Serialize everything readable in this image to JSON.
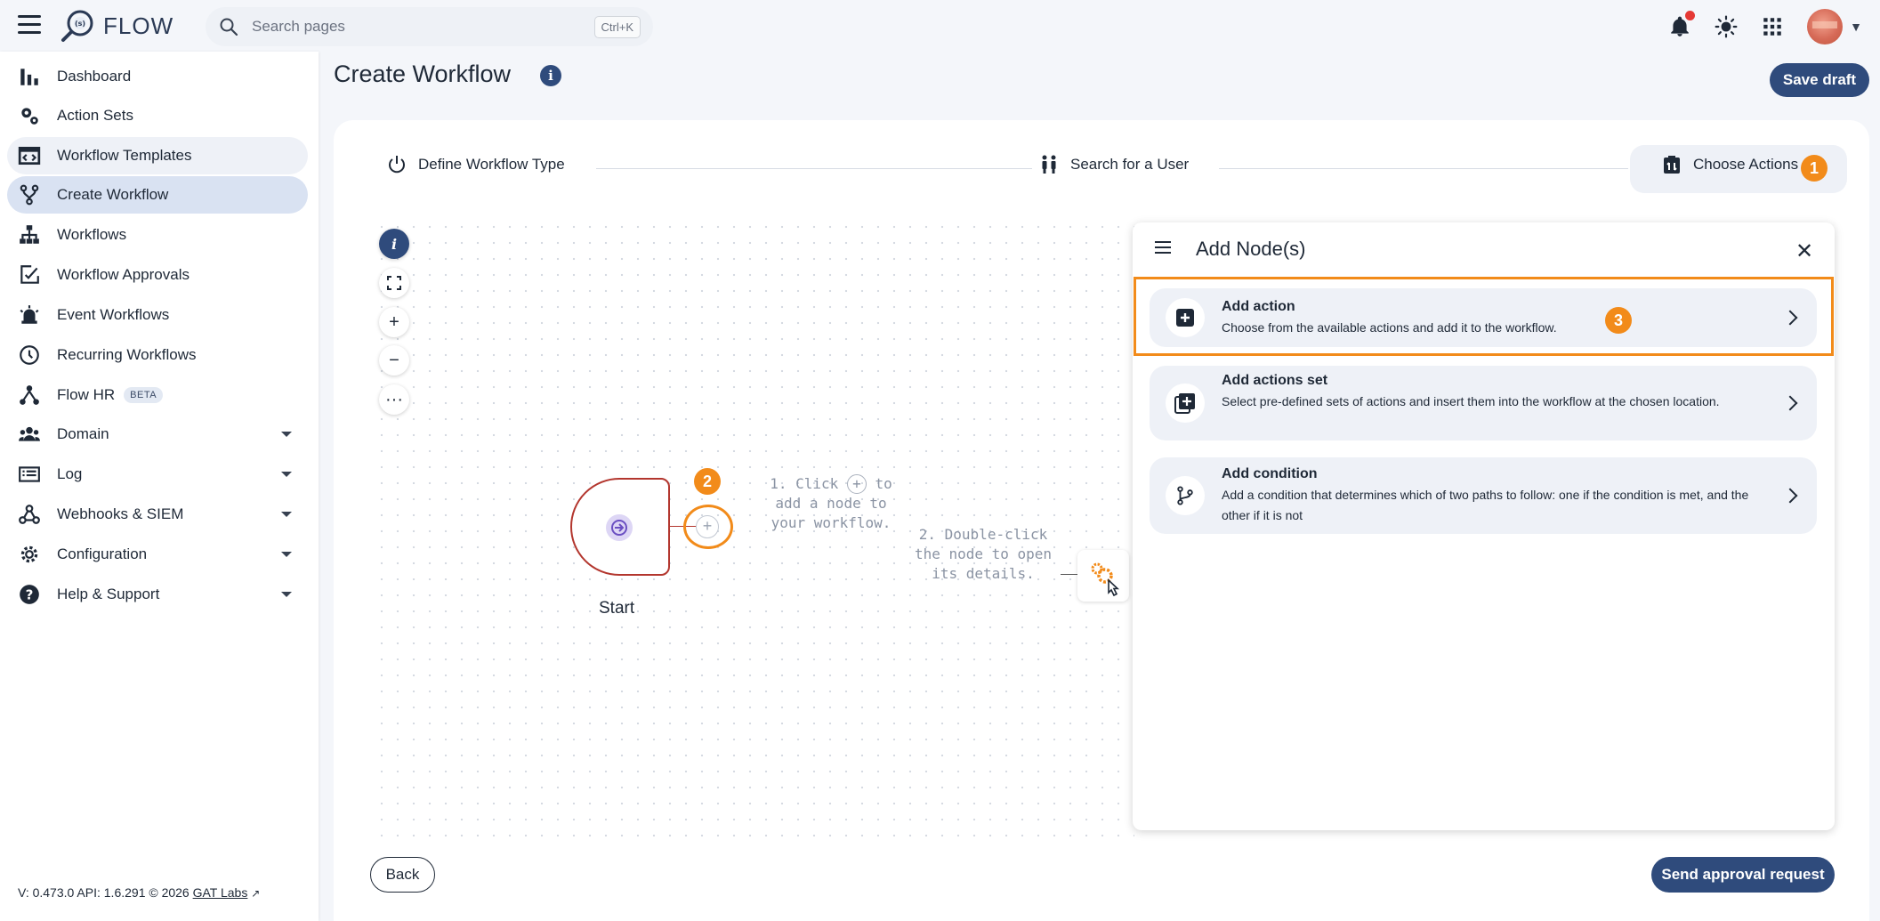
{
  "app": {
    "name": "FLOW"
  },
  "search": {
    "placeholder": "Search pages",
    "shortcut": "Ctrl+K"
  },
  "topbar": {
    "icons": [
      "notification-bell-icon",
      "theme-sun-icon",
      "apps-grid-icon",
      "avatar",
      "chevron-down-icon"
    ]
  },
  "sidebar": {
    "items": [
      {
        "label": "Dashboard",
        "icon": "bar-chart-icon"
      },
      {
        "label": "Action Sets",
        "icon": "gears-icon"
      },
      {
        "label": "Workflow Templates",
        "icon": "template-icon"
      },
      {
        "label": "Create Workflow",
        "icon": "branch-icon"
      },
      {
        "label": "Workflows",
        "icon": "sitemap-icon"
      },
      {
        "label": "Workflow Approvals",
        "icon": "approval-icon"
      },
      {
        "label": "Event Workflows",
        "icon": "alarm-light-icon"
      },
      {
        "label": "Recurring Workflows",
        "icon": "clock-icon"
      },
      {
        "label": "Flow HR",
        "icon": "hr-tree-icon",
        "badge": "BETA"
      },
      {
        "label": "Domain",
        "icon": "users-icon"
      },
      {
        "label": "Log",
        "icon": "log-icon"
      },
      {
        "label": "Webhooks & SIEM",
        "icon": "webhook-icon"
      },
      {
        "label": "Configuration",
        "icon": "gear-icon"
      },
      {
        "label": "Help & Support",
        "icon": "help-icon"
      }
    ],
    "version": "V: 0.473.0  API: 1.6.291  © 2026 ",
    "company_link": "GAT Labs"
  },
  "page": {
    "title": "Create Workflow",
    "save_draft": "Save draft"
  },
  "stepper": {
    "steps": [
      "Define Workflow Type",
      "Search for a User",
      "Choose Actions"
    ]
  },
  "callouts": {
    "one": "1",
    "two": "2",
    "three": "3"
  },
  "canvas": {
    "start_label": "Start",
    "hint_1_line1": "1. Click",
    "hint_1_line1b": "to",
    "hint_1_line2": "add a node to",
    "hint_1_line3": "your workflow.",
    "hint_2_line1": "2. Double-click",
    "hint_2_line2": "the node to open",
    "hint_2_line3": "its details."
  },
  "panel": {
    "title": "Add Node(s)",
    "options": [
      {
        "title": "Add action",
        "description": "Choose from the available actions and add it to the workflow."
      },
      {
        "title": "Add actions set",
        "description": "Select pre-defined sets of actions and insert them into the workflow at the chosen location."
      },
      {
        "title": "Add condition",
        "description": "Add a condition that determines which of two paths to follow: one if the condition is met, and the other if it is not"
      }
    ]
  },
  "footer": {
    "back": "Back",
    "send": "Send approval request"
  },
  "colors": {
    "primary": "#2f4b7c",
    "callout": "#f28b1a",
    "start_border": "#b3362e"
  }
}
